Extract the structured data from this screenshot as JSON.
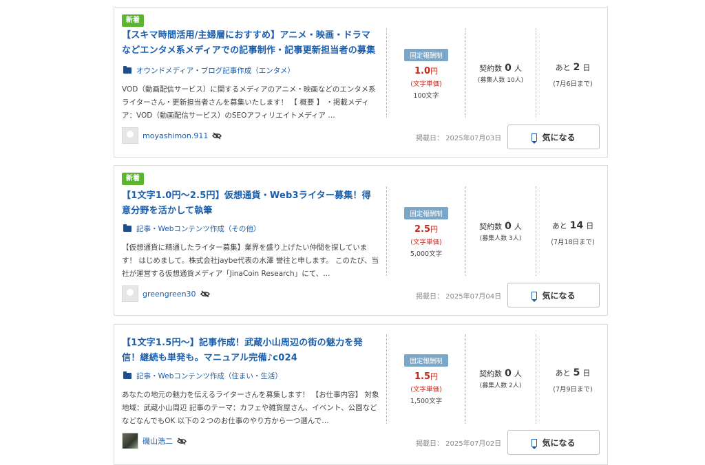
{
  "jobs": [
    {
      "badge": "新着",
      "title": "【スキマ時間活用/主婦層におすすめ】アニメ・映画・ドラマなどエンタメ系メディアでの記事制作・記事更新担当者の募集",
      "category": "オウンドメディア・ブログ記事作成（エンタメ）",
      "description": "VOD（動画配信サービス）に関するメディアのアニメ・映画などのエンタメ系ライターさん・更新担当者さんを募集いたします！ 【 概要 】 ・掲載メディア：VOD（動画配信サービス）のSEOアフィリエイトメディア …",
      "username": "moyashimon.911",
      "price_type": "固定報酬制",
      "price_value": "1.0",
      "price_unit": "円",
      "price_sub": "(文字単価)",
      "price_count": "100文字",
      "contract_label": "契約数",
      "contract_count": "0",
      "contract_unit": "人",
      "contract_sub": "(募集人数 10人)",
      "remain_prefix": "あと",
      "remain_days": "2",
      "remain_unit": "日",
      "remain_until": "(7月6日まで)",
      "posted": "掲載日： 2025年07月03日",
      "fav_label": "気になる"
    },
    {
      "badge": "新着",
      "title": "【1文字1.0円～2.5円】仮想通貨・Web3ライター募集！得意分野を活かして執筆",
      "category": "記事・Webコンテンツ作成（その他）",
      "description": "【仮想通貨に精通したライター募集】業界を盛り上げたい仲間を探しています！ はじめまして。株式会社jaybe代表の水澤 誉往と申します。 このたび、当社が運営する仮想通貨メディア「JinaCoin Research」にて、…",
      "username": "greengreen30",
      "price_type": "固定報酬制",
      "price_value": "2.5",
      "price_unit": "円",
      "price_sub": "(文字単価)",
      "price_count": "5,000文字",
      "contract_label": "契約数",
      "contract_count": "0",
      "contract_unit": "人",
      "contract_sub": "(募集人数 3人)",
      "remain_prefix": "あと",
      "remain_days": "14",
      "remain_unit": "日",
      "remain_until": "(7月18日まで)",
      "posted": "掲載日： 2025年07月04日",
      "fav_label": "気になる"
    },
    {
      "badge": "",
      "title": "【1文字1.5円～】記事作成！武蔵小山周辺の街の魅力を発信！継続も単発も。マニュアル完備♪c024",
      "category": "記事・Webコンテンツ作成（住まい・生活）",
      "description": "あなたの地元の魅力を伝えるライターさんを募集します！ 【お仕事内容】 対象地域：武蔵小山周辺 記事のテーマ：カフェや雑貨屋さん、イベント、公園などなどなんでもOK 以下の２つのお仕事のやり方から一つ選んで…",
      "username": "磯山浩二",
      "price_type": "固定報酬制",
      "price_value": "1.5",
      "price_unit": "円",
      "price_sub": "(文字単価)",
      "price_count": "1,500文字",
      "contract_label": "契約数",
      "contract_count": "0",
      "contract_unit": "人",
      "contract_sub": "(募集人数 2人)",
      "remain_prefix": "あと",
      "remain_days": "5",
      "remain_unit": "日",
      "remain_until": "(7月9日まで)",
      "posted": "掲載日： 2025年07月02日",
      "fav_label": "気になる"
    }
  ],
  "colors": {
    "link": "#1a5dab",
    "price": "#c5271b",
    "new_badge": "#5cb531",
    "fixed_badge": "#7aa7c7"
  },
  "icons": {
    "category": "folder-icon",
    "hidden": "eye-slash-icon",
    "favorite": "bookmark-icon"
  }
}
